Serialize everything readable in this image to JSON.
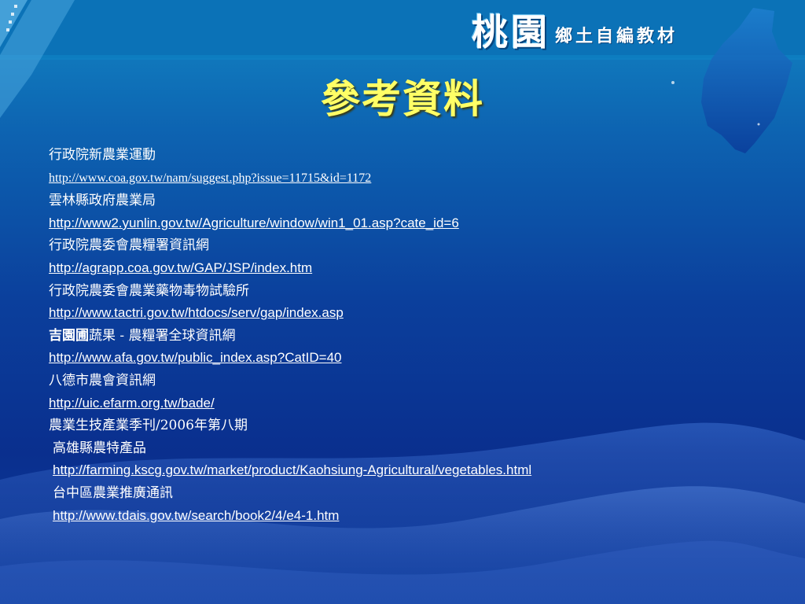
{
  "header": {
    "brand_main": "桃園",
    "brand_sub": "鄉土自編教材"
  },
  "title": "參考資料",
  "references": [
    {
      "text": "行政院新農業運動"
    },
    {
      "link": "http://www.coa.gov.tw/nam/suggest.php?issue=11715&id=1172"
    },
    {
      "text": "雲林縣政府農業局"
    },
    {
      "link": "http://www2.yunlin.gov.tw/Agriculture/window/win1_01.asp?cate_id=6"
    },
    {
      "text": "行政院農委會農糧署資訊網"
    },
    {
      "link": " http://agrapp.coa.gov.tw/GAP/JSP/index.htm"
    },
    {
      "text": "行政院農委會農業藥物毒物試驗所"
    },
    {
      "link": "http://www.tactri.gov.tw/htdocs/serv/gap/index.asp"
    },
    {
      "text_bold": "吉園圃",
      "text": "蔬果 - 農糧署全球資訊網"
    },
    {
      "link": "http://www.afa.gov.tw/public_index.asp?CatID=40"
    },
    {
      "text": "八德市農會資訊網"
    },
    {
      "link": "http://uic.efarm.org.tw/bade/"
    },
    {
      "text": "農業生技產業季刊/2006年第八期"
    },
    {
      "text": "高雄縣農特產品"
    },
    {
      "link": "http://farming.kscg.gov.tw/market/product/Kaohsiung-Agricultural/vegetables.html"
    },
    {
      "text": "台中區農業推廣通訊"
    },
    {
      "link": "http://www.tdais.gov.tw/search/book2/4/e4-1.htm"
    }
  ],
  "colors": {
    "title": "#ffff66",
    "text": "#ffffff",
    "background_top": "#1287c4",
    "background_bottom": "#0a2f8e"
  }
}
